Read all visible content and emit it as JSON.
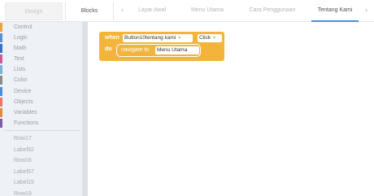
{
  "modes": {
    "design": "Design",
    "blocks": "Blocks"
  },
  "screens": [
    {
      "label": "Layar Awal",
      "active": false
    },
    {
      "label": "Menu Utama",
      "active": false
    },
    {
      "label": "Cara Penggunaan",
      "active": false
    },
    {
      "label": "Tentang Kami",
      "active": true
    }
  ],
  "icons": {
    "left_arrow": "chevron-left-icon",
    "right_arrow": "chevron-right-icon",
    "dropdown": "triangle-down-icon"
  },
  "categories": [
    {
      "label": "Control",
      "color": "#e7a53a"
    },
    {
      "label": "Logic",
      "color": "#5b8fd0"
    },
    {
      "label": "Math",
      "color": "#3b6fc7"
    },
    {
      "label": "Text",
      "color": "#c75b93"
    },
    {
      "label": "Lists",
      "color": "#77b1d6"
    },
    {
      "label": "Color",
      "color": "#8a8a8a"
    },
    {
      "label": "Device",
      "color": "#4a8fd9"
    },
    {
      "label": "Objects",
      "color": "#e8766d"
    },
    {
      "label": "Variables",
      "color": "#e08a3e"
    },
    {
      "label": "Functions",
      "color": "#7d5ba6"
    }
  ],
  "components": [
    "Row17",
    "Label92",
    "Row16",
    "Label57",
    "Label15",
    "Row19"
  ],
  "block": {
    "when": "when",
    "component": "Button10tentang kami",
    "event": "Click",
    "do": "do",
    "action": "navigate to",
    "target": "Menu Utama"
  }
}
